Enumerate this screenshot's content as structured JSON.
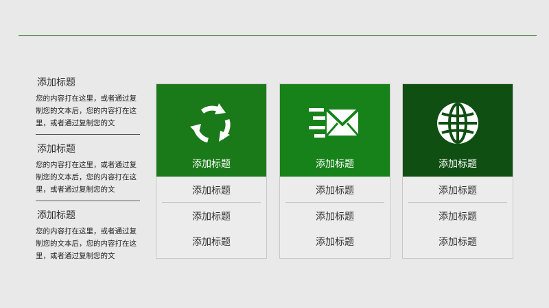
{
  "colors": {
    "background": "#e9e9e9",
    "accent_line": "#1f7a1f",
    "card1_header": "#1a7a19",
    "card2_header": "#17821a",
    "card3_header": "#0f4f12"
  },
  "left_blocks": [
    {
      "title": "添加标题",
      "body": "您的内容打在这里，或者通过复制您的文本后，您的内容打在这里，或者通过复制您的文"
    },
    {
      "title": "添加标题",
      "body": "您的内容打在这里，或者通过复制您的文本后，您的内容打在这里，或者通过复制您的文"
    },
    {
      "title": "添加标题",
      "body": "您的内容打在这里，或者通过复制您的文本后，您的内容打在这里，或者通过复制您的文"
    }
  ],
  "cards": [
    {
      "icon": "recycle-icon",
      "title": "添加标题",
      "items": [
        "添加标题",
        "添加标题",
        "添加标题"
      ]
    },
    {
      "icon": "mail-fast-icon",
      "title": "添加标题",
      "items": [
        "添加标题",
        "添加标题",
        "添加标题"
      ]
    },
    {
      "icon": "globe-icon",
      "title": "添加标题",
      "items": [
        "添加标题",
        "添加标题",
        "添加标题"
      ]
    }
  ]
}
